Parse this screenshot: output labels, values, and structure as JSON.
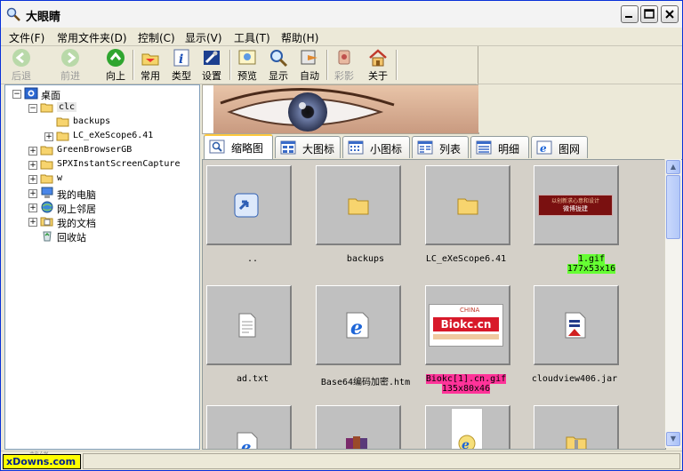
{
  "window": {
    "title": "大眼睛"
  },
  "menu": [
    "文件(F)",
    "常用文件夹(D)",
    "控制(C)",
    "显示(V)",
    "工具(T)",
    "帮助(H)"
  ],
  "toolbar": {
    "back": "后退",
    "forward": "前进",
    "up": "向上",
    "common": "常用",
    "type": "类型",
    "settings": "设置",
    "preview": "预览",
    "display": "显示",
    "auto": "自动",
    "color": "彩影",
    "about": "关于"
  },
  "tree": {
    "root": "桌面",
    "items": [
      "clc",
      "backups",
      "LC_eXeScope6.41",
      "GreenBrowserGB",
      "SPXInstantScreenCapture",
      "w",
      "我的电脑",
      "网上邻居",
      "我的文档",
      "回收站"
    ]
  },
  "tabs": [
    "缩略图",
    "大图标",
    "小图标",
    "列表",
    "明细",
    "图网"
  ],
  "grid": {
    "items": [
      {
        "name": "..",
        "info": ""
      },
      {
        "name": "backups",
        "info": ""
      },
      {
        "name": "LC_eXeScope6.41",
        "info": ""
      },
      {
        "name": "1.gif",
        "info": "177x53x16"
      },
      {
        "name": "ad.txt",
        "info": ""
      },
      {
        "name": "Base64编码加密.htm",
        "info": ""
      },
      {
        "name": "Biokc[1].cn.gif",
        "info": "135x80x46"
      },
      {
        "name": "cloudview406.jar",
        "info": ""
      }
    ],
    "thumb_texts": {
      "gif1_line1": "以创新求心意和设计",
      "gif1_line2": "微博拢建",
      "biokc_top": "CHINA",
      "biokc_main": "Biokc.cn"
    }
  },
  "status": {
    "label": "xDowns.com",
    "ghost": "就绪"
  },
  "colors": {
    "accent": "#0831D9",
    "highlight_green": "#66ff33",
    "highlight_pink": "#ff3399"
  }
}
